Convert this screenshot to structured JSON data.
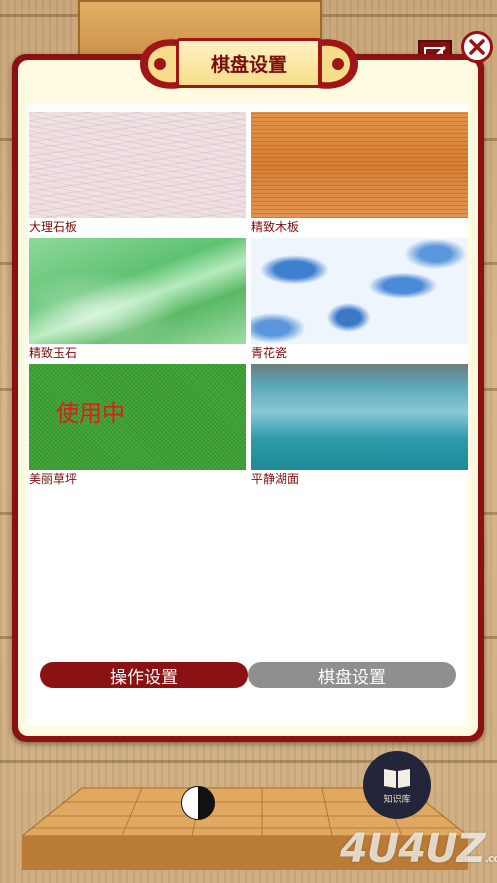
{
  "dialog": {
    "title": "棋盘设置"
  },
  "boards": [
    {
      "name": "大理石板",
      "texture": "marble",
      "in_use": false
    },
    {
      "name": "精致木板",
      "texture": "wood",
      "in_use": false
    },
    {
      "name": "精致玉石",
      "texture": "jade",
      "in_use": false
    },
    {
      "name": "青花瓷",
      "texture": "porcelain",
      "in_use": false
    },
    {
      "name": "美丽草坪",
      "texture": "grass",
      "in_use": true
    },
    {
      "name": "平静湖面",
      "texture": "lake",
      "in_use": false
    }
  ],
  "in_use_label": "使用中",
  "tabs": {
    "operation": "操作设置",
    "board": "棋盘设置"
  },
  "knowledge_base": {
    "label": "知识库"
  },
  "watermark": {
    "text": "4U4UZ",
    "suffix": ".com"
  },
  "colors": {
    "frame": "#8c1111",
    "active_tab": "#8a1212",
    "inactive_tab": "#8f8f8f",
    "label": "#7a0d0d",
    "in_use": "#e01b1b"
  }
}
